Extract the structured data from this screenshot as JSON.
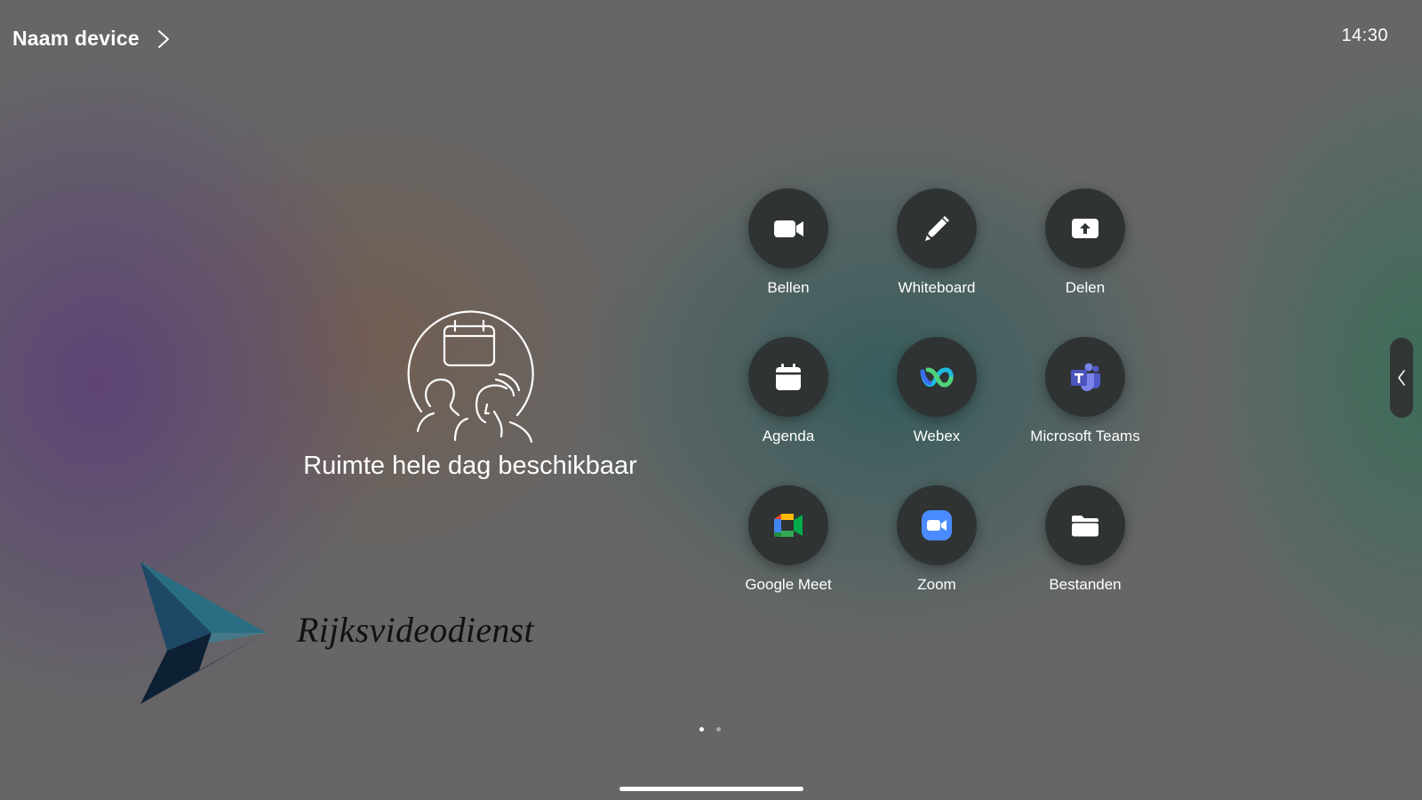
{
  "header": {
    "device_name": "Naam device",
    "chevron_icon": "chevron-right-icon",
    "time": "14:30"
  },
  "status": {
    "illustration_icon": "calendar-people-icon",
    "text": "Ruimte hele dag beschikbaar"
  },
  "branding": {
    "wordmark": "Rijksvideodienst",
    "logo_colors": [
      "#2a6e83",
      "#1d4866",
      "#0e2034",
      "#3d7f8f"
    ]
  },
  "apps": [
    {
      "label": "Bellen",
      "icon": "video-camera-icon"
    },
    {
      "label": "Whiteboard",
      "icon": "pencil-icon"
    },
    {
      "label": "Delen",
      "icon": "share-screen-icon"
    },
    {
      "label": "Agenda",
      "icon": "calendar-icon"
    },
    {
      "label": "Webex",
      "icon": "webex-icon"
    },
    {
      "label": "Microsoft Teams",
      "icon": "microsoft-teams-icon"
    },
    {
      "label": "Google Meet",
      "icon": "google-meet-icon"
    },
    {
      "label": "Zoom",
      "icon": "zoom-icon"
    },
    {
      "label": "Bestanden",
      "icon": "folder-icon"
    }
  ],
  "pager": {
    "page": 1,
    "pages": 2
  },
  "colors": {
    "tile_background": "#2f3333",
    "text": "#ffffff",
    "zoom_blue": "#4a8cff",
    "teams_purple": "#5b5fc7"
  }
}
